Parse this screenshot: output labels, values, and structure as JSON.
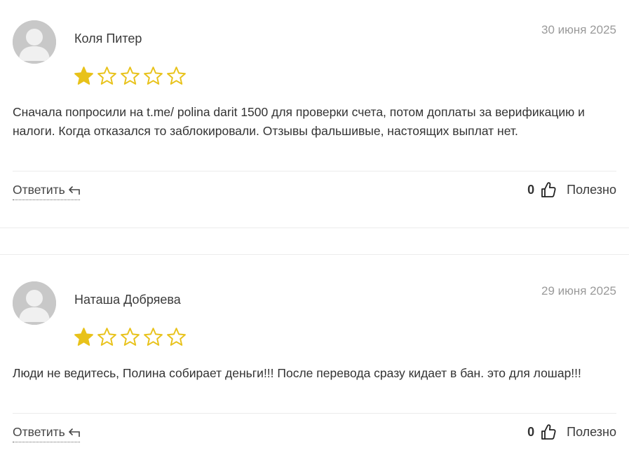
{
  "reviews": [
    {
      "author": "Коля Питер",
      "date": "30 июня 2025",
      "rating": 1,
      "max_rating": 5,
      "text": "Сначала попросили на t.me/ polina darit 1500 для проверки счета, потом доплаты за верификацию и налоги. Когда отказался то заблокировали. Отзывы фальшивые, настоящих выплат нет.",
      "reply_label": "Ответить",
      "helpful_count": "0",
      "helpful_label": "Полезно"
    },
    {
      "author": "Наташа Добряева",
      "date": "29 июня 2025",
      "rating": 1,
      "max_rating": 5,
      "text": "Люди не ведитесь, Полина собирает деньги!!! После перевода сразу кидает в бан. это для лошар!!!",
      "reply_label": "Ответить",
      "helpful_count": "0",
      "helpful_label": "Полезно"
    }
  ],
  "icons": {
    "star_filled": "star-filled-icon",
    "star_empty": "star-empty-icon",
    "reply": "reply-arrow-icon",
    "thumb": "thumbs-up-icon",
    "avatar": "default-avatar-icon"
  },
  "colors": {
    "star": "#E8C21A",
    "date": "#9A9A9A",
    "text": "#333333",
    "divider": "#ECECEC",
    "avatar_bg": "#C8C8C8"
  }
}
